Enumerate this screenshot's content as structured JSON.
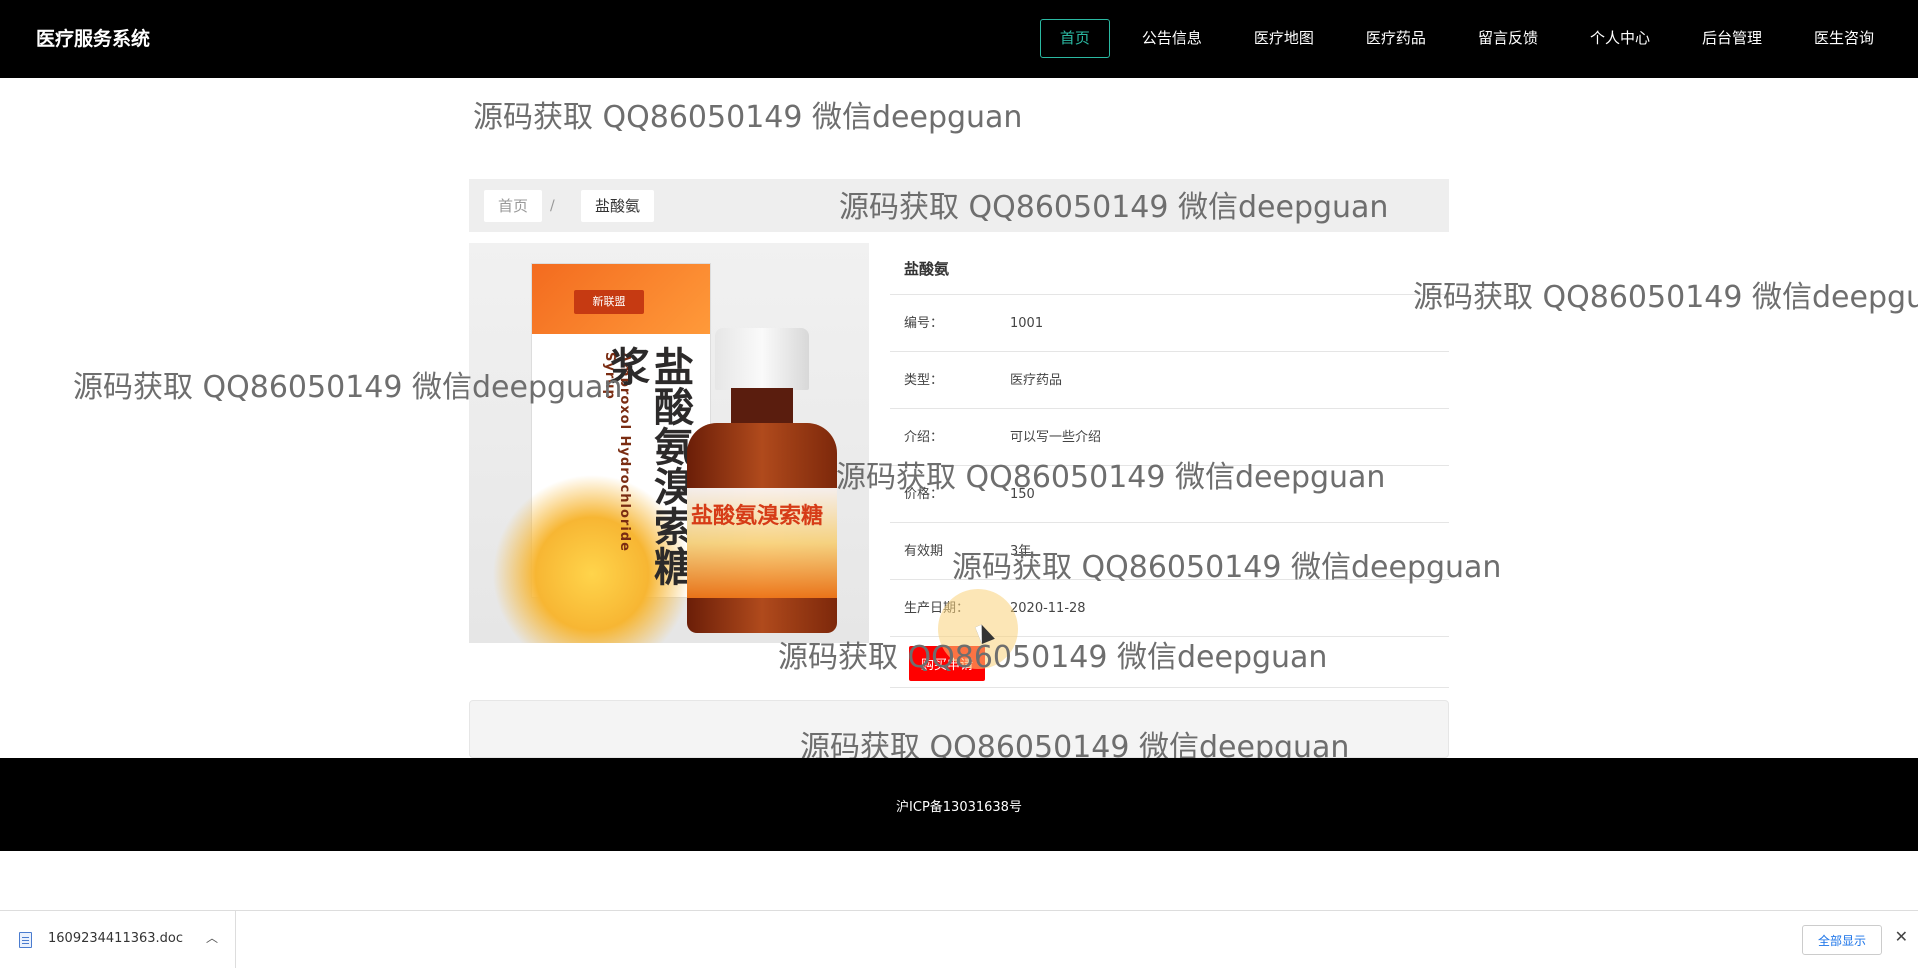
{
  "header": {
    "brand": "医疗服务系统",
    "nav": [
      "首页",
      "公告信息",
      "医疗地图",
      "医疗药品",
      "留言反馈",
      "个人中心",
      "后台管理",
      "医生咨询"
    ]
  },
  "watermark": "源码获取 QQ86050149 微信deepguan",
  "watermark_partial": "源码获取 QQ86050149 微信deepgua",
  "breadcrumb": {
    "home": "首页",
    "separator": "/",
    "current": "盐酸氨"
  },
  "product": {
    "image": {
      "brand": "新联盟",
      "title": "盐酸氨溴索糖浆",
      "english": "Ambroxol Hydrochloride Syrup",
      "bottle_label": "盐酸氨溴索糖"
    },
    "title": "盐酸氨",
    "fields": [
      {
        "label": "编号：",
        "value": "1001"
      },
      {
        "label": "类型：",
        "value": "医疗药品"
      },
      {
        "label": "介绍：",
        "value": "可以写一些介绍"
      },
      {
        "label": "价格：",
        "value": "150"
      },
      {
        "label": "有效期",
        "value": "3年"
      },
      {
        "label": "生产日期：",
        "value": "2020-11-28"
      }
    ],
    "buy_label": "购买申请"
  },
  "footer": {
    "icp": "沪ICP备13031638号"
  },
  "download_bar": {
    "file_name": "1609234411363.doc",
    "show_all": "全部显示"
  }
}
